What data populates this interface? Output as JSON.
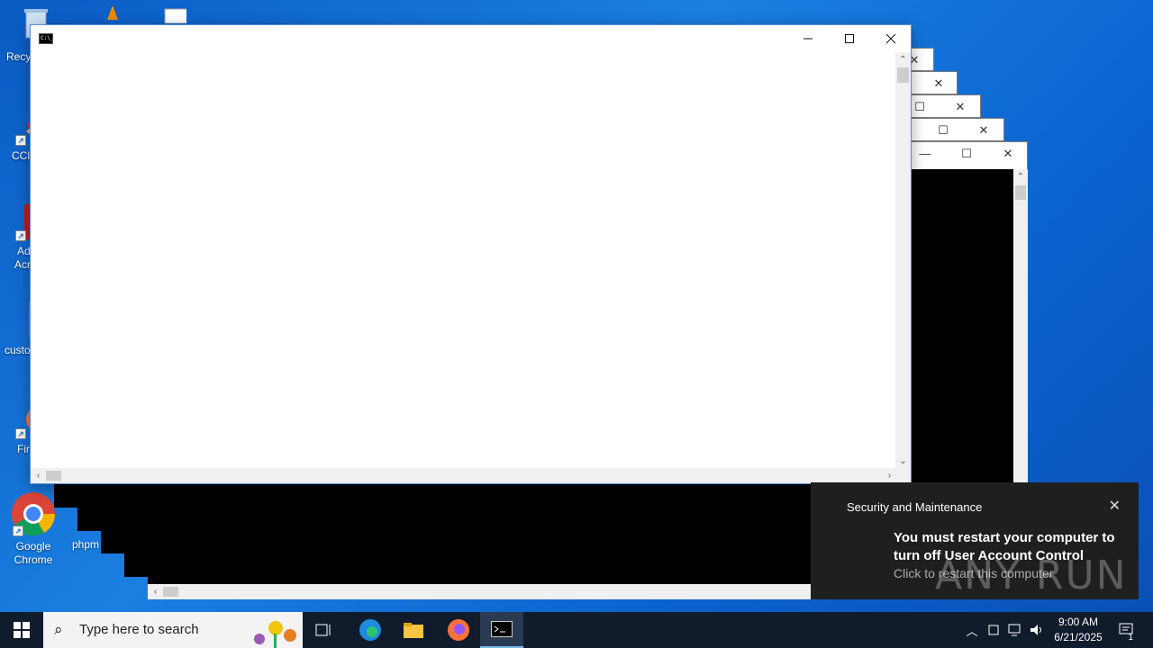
{
  "desktop": {
    "icons": [
      {
        "label": "Recy"
      },
      {
        "label": "CCl"
      },
      {
        "label": "Ad"
      },
      {
        "label": "Acr"
      },
      {
        "label": "custo"
      },
      {
        "label": "Fir"
      },
      {
        "label": "Google"
      },
      {
        "label": "Chrome"
      },
      {
        "label": "phpm"
      }
    ]
  },
  "toast": {
    "app_name": "Security and Maintenance",
    "title": "You must restart your computer to turn off User Account Control",
    "body": "Click to restart this computer",
    "close_glyph": "✕"
  },
  "watermark": "ANY RUN",
  "taskbar": {
    "search_placeholder": "Type here to search",
    "time": "9:00 AM",
    "date": "6/21/2025",
    "notification_count": "1"
  },
  "colors": {
    "desktop_blue": "#0b63d0",
    "taskbar": "#101c2c",
    "toast_bg": "#1f1f1f"
  }
}
